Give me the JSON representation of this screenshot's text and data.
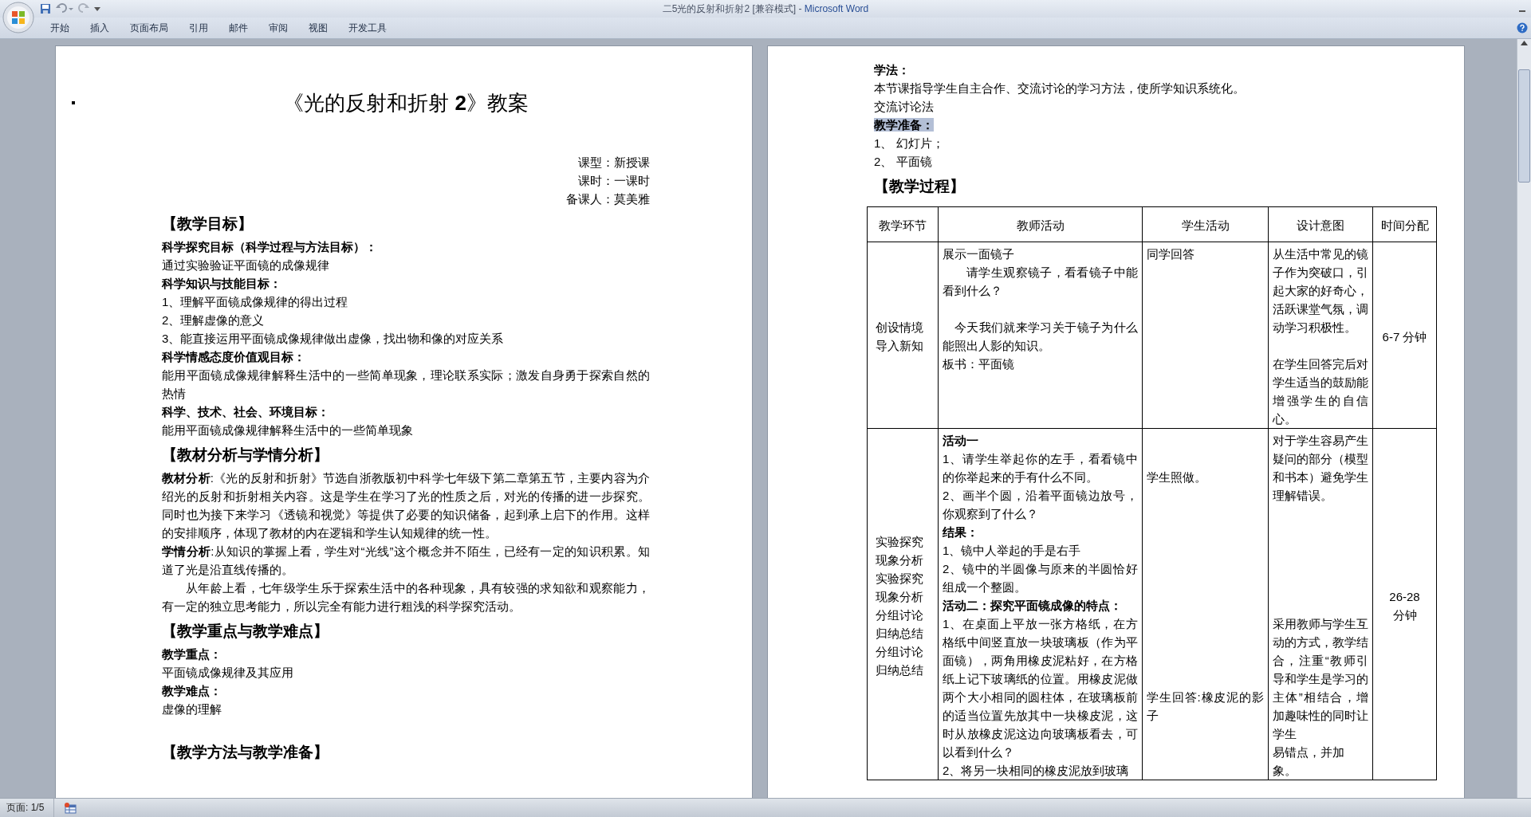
{
  "window": {
    "document": "二5光的反射和折射2 [兼容模式]",
    "separator": "-",
    "app": "Microsoft Word"
  },
  "ribbon_tabs": [
    "开始",
    "插入",
    "页面布局",
    "引用",
    "邮件",
    "审阅",
    "视图",
    "开发工具"
  ],
  "pages": [
    {
      "blocks": [
        {
          "kind": "title",
          "text": "《光的反射和折射 **2**》教案"
        },
        {
          "kind": "meta",
          "text": "课型：新授课"
        },
        {
          "kind": "meta",
          "text": "课时：一课时"
        },
        {
          "kind": "meta",
          "text": "备课人：莫美雅"
        },
        {
          "kind": "heading",
          "text": "【教学目标】"
        },
        {
          "kind": "bold",
          "text": "科学探究目标（科学过程与方法目标）："
        },
        {
          "kind": "text",
          "text": "通过实验验证平面镜的成像规律"
        },
        {
          "kind": "bold",
          "text": "科学知识与技能目标："
        },
        {
          "kind": "text",
          "text": "1、理解平面镜成像规律的得出过程"
        },
        {
          "kind": "text",
          "text": "2、理解虚像的意义"
        },
        {
          "kind": "text",
          "text": "3、能直接运用平面镜成像规律做出虚像，找出物和像的对应关系"
        },
        {
          "kind": "bold",
          "text": "科学情感态度价值观目标："
        },
        {
          "kind": "text",
          "text": "能用平面镜成像规律解释生活中的一些简单现象，理论联系实际；激发自身勇于探索自然的热情"
        },
        {
          "kind": "bold",
          "text": "科学、技术、社会、环境目标："
        },
        {
          "kind": "text",
          "text": "能用平面镜成像规律解释生活中的一些简单现象"
        },
        {
          "kind": "heading",
          "text": "【教材分析与学情分析】"
        },
        {
          "kind": "text",
          "text": "**教材分析**:《光的反射和折射》节选自浙教版初中科学七年级下第二章第五节，主要内容为介绍光的反射和折射相关内容。这是学生在学习了光的性质之后，对光的传播的进一步探究。同时也为接下来学习《透镜和视觉》等提供了必要的知识储备，起到承上启下的作用。这样的安排顺序，体现了教材的内在逻辑和学生认知规律的统一性。"
        },
        {
          "kind": "text",
          "text": "**学情分析**:从知识的掌握上看，学生对“光线”这个概念并不陌生，已经有一定的知识积累。知道了光是沿直线传播的。"
        },
        {
          "kind": "indent",
          "text": "从年龄上看，七年级学生乐于探索生活中的各种现象，具有较强的求知欲和观察能力，有一定的独立思考能力，所以完全有能力进行粗浅的科学探究活动。"
        },
        {
          "kind": "heading",
          "text": "【教学重点与教学难点】"
        },
        {
          "kind": "bold",
          "text": "教学重点："
        },
        {
          "kind": "text",
          "text": "平面镜成像规律及其应用"
        },
        {
          "kind": "bold",
          "text": "教学难点："
        },
        {
          "kind": "text",
          "text": "虚像的理解"
        },
        {
          "kind": "blank"
        },
        {
          "kind": "heading",
          "text": "【教学方法与教学准备】"
        }
      ]
    },
    {
      "blocks": [
        {
          "kind": "bold",
          "text": "学法："
        },
        {
          "kind": "text",
          "text": "本节课指导学生自主合作、交流讨论的学习方法，使所学知识系统化。"
        },
        {
          "kind": "text",
          "text": "交流讨论法"
        },
        {
          "kind": "selection",
          "text": "教学准备："
        },
        {
          "kind": "text",
          "text": "1、 幻灯片；"
        },
        {
          "kind": "text",
          "text": "2、 平面镜"
        },
        {
          "kind": "heading",
          "text": "【教学过程】"
        }
      ],
      "table": {
        "columns": [
          "教学环节",
          "教师活动",
          "学生活动",
          "设计意图",
          "时间分配"
        ],
        "rows": [
          [
            [
              {
                "kind": "text",
                "text": "创设情境"
              },
              {
                "kind": "text",
                "text": "导入新知"
              }
            ],
            [
              {
                "kind": "text",
                "text": "展示一面镜子"
              },
              {
                "kind": "indent",
                "text": "请学生观察镜子，看看镜子中能看到什么？"
              },
              {
                "kind": "blank"
              },
              {
                "kind": "half-indent",
                "text": "今天我们就来学习关于镜子为什么能照出人影的知识。"
              },
              {
                "kind": "text",
                "text": "板书：平面镜"
              }
            ],
            [
              {
                "kind": "text",
                "text": "同学回答"
              }
            ],
            [
              {
                "kind": "text",
                "text": "从生活中常见的镜子作为突破口，引起大家的好奇心，活跃课堂气氛，调动学习积极性。"
              },
              {
                "kind": "blank"
              },
              {
                "kind": "text",
                "text": "在学生回答完后对学生适当的鼓励能增强学生的自信心。"
              }
            ],
            [
              {
                "kind": "text",
                "text": "6-7 分钟"
              }
            ]
          ],
          [
            [
              {
                "kind": "text",
                "text": "实验探究现象分析"
              },
              {
                "kind": "text",
                "text": "实验探究现象分析"
              },
              {
                "kind": "text",
                "text": "分组讨论归纳总结"
              },
              {
                "kind": "text",
                "text": "分组讨论归纳总结"
              }
            ],
            [
              {
                "kind": "bold",
                "text": "活动一"
              },
              {
                "kind": "text",
                "text": "1、请学生举起你的左手，看看镜中的你举起来的手有什么不同。"
              },
              {
                "kind": "text",
                "text": "2、画半个圆，沿着平面镜边放号，你观察到了什么？"
              },
              {
                "kind": "bold",
                "text": "结果："
              },
              {
                "kind": "text",
                "text": "1、镜中人举起的手是右手"
              },
              {
                "kind": "text",
                "text": "2、镜中的半圆像与原来的半圆恰好组成一个整圆。"
              },
              {
                "kind": "bold",
                "text": "活动二：探究平面镜成像的特点："
              },
              {
                "kind": "text",
                "text": "1、在桌面上平放一张方格纸，在方格纸中间竖直放一块玻璃板（作为平面镜），两角用橡皮泥粘好，在方格纸上记下玻璃纸的位置。用橡皮泥做两个大小相同的圆柱体，在玻璃板前的适当位置先放其中一块橡皮泥，这时从放橡皮泥这边向玻璃板看去，可以看到什么？"
              },
              {
                "kind": "text",
                "text": "2、将另一块相同的橡皮泥放到玻璃"
              }
            ],
            [
              {
                "kind": "blank"
              },
              {
                "kind": "blank"
              },
              {
                "kind": "text",
                "text": "学生照做。"
              },
              {
                "kind": "blank"
              },
              {
                "kind": "blank"
              },
              {
                "kind": "blank"
              },
              {
                "kind": "blank"
              },
              {
                "kind": "blank"
              },
              {
                "kind": "blank"
              },
              {
                "kind": "blank"
              },
              {
                "kind": "blank"
              },
              {
                "kind": "blank"
              },
              {
                "kind": "blank"
              },
              {
                "kind": "blank"
              },
              {
                "kind": "text",
                "text": "学生回答:橡皮泥的影子"
              },
              {
                "kind": "blank"
              },
              {
                "kind": "blank"
              },
              {
                "kind": "blank"
              }
            ],
            [
              {
                "kind": "text",
                "text": "对于学生容易产生疑问的部分（模型和书本）避免学生理解错误。"
              },
              {
                "kind": "blank"
              },
              {
                "kind": "blank"
              },
              {
                "kind": "blank"
              },
              {
                "kind": "blank"
              },
              {
                "kind": "blank"
              },
              {
                "kind": "blank"
              },
              {
                "kind": "text",
                "text": "采用教师与学生互动的方式，教学结合，注重“教师引导和学生是学习的主体”相结合，增加趣味性的同时让学生"
              },
              {
                "kind": "text",
                "text": "易错点，并加"
              },
              {
                "kind": "text",
                "text": "象。"
              }
            ],
            [
              {
                "kind": "text",
                "text": "26-28"
              },
              {
                "kind": "text",
                "text": "分钟"
              }
            ]
          ]
        ]
      }
    }
  ],
  "status_bar": {
    "page": "页面: 1/5"
  }
}
